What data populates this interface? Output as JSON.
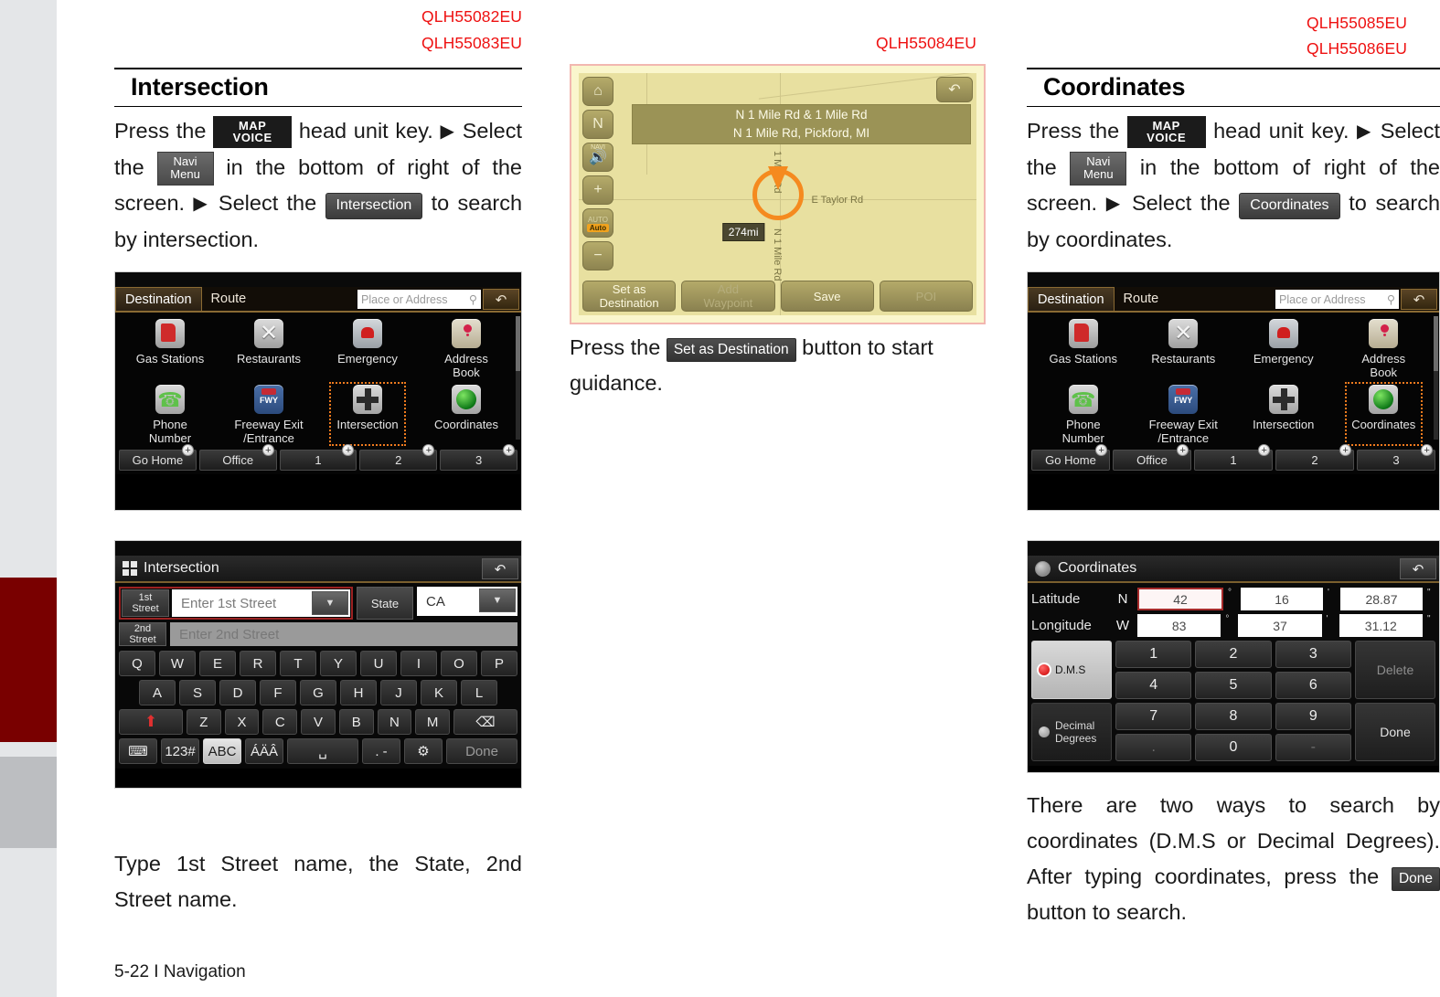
{
  "page": {
    "footer": "5-22 I Navigation"
  },
  "codes": {
    "left_1": "QLH55082EU",
    "left_2": "QLH55083EU",
    "mid_1": "QLH55084EU",
    "right_1": "QLH55085EU",
    "right_2": "QLH55086EU"
  },
  "left_column": {
    "heading": "Intersection",
    "intro": {
      "t1": "Press the",
      "chip_mapvoice_line1": "MAP",
      "chip_mapvoice_line2": "VOICE",
      "t2": "head unit key.",
      "t3": "Select",
      "t4": "the",
      "chip_navi_line1": "Navi",
      "chip_navi_line2": "Menu",
      "t5": "in the bottom of right of the",
      "t6": "screen.",
      "t7": "Select the",
      "chip_action": "Intersection",
      "t8": "to",
      "t9": "search by intersection."
    },
    "caption": "Type 1st Street name, the State, 2nd Street name."
  },
  "mid_column": {
    "caption": {
      "t1": "Press the",
      "chip_action": "Set as Destination",
      "t2": "button to start guidance."
    }
  },
  "right_column": {
    "heading": "Coordinates",
    "intro": {
      "t1": "Press the",
      "chip_mapvoice_line1": "MAP",
      "chip_mapvoice_line2": "VOICE",
      "t2": "head unit key.",
      "t3": "Select",
      "t4": "the",
      "chip_navi_line1": "Navi",
      "chip_navi_line2": "Menu",
      "t5": "in the bottom of right of the",
      "t6": "screen.",
      "t7": "Select the",
      "chip_action": "Coordinates",
      "t8": "to",
      "t9": "search by coordinates."
    },
    "caption": {
      "t1": "There are two ways to search by coordinates (D.M.S or Decimal Degrees). After typing coordinates, press the",
      "chip_action": "Done",
      "t2": "button to search."
    }
  },
  "destination_screen": {
    "tabs": [
      {
        "label": "Destination",
        "active": true
      },
      {
        "label": "Route",
        "active": false
      }
    ],
    "search_placeholder": "Place or Address",
    "search_icon": "magnifier-icon",
    "back_icon": "back-arrow-icon",
    "items": [
      {
        "label": "Gas Stations",
        "icon": "gas-station-icon"
      },
      {
        "label": "Restaurants",
        "icon": "restaurant-icon"
      },
      {
        "label": "Emergency",
        "icon": "emergency-icon"
      },
      {
        "label": "Address\nBook",
        "icon": "address-book-icon"
      },
      {
        "label": "Phone\nNumber",
        "icon": "phone-icon"
      },
      {
        "label": "Freeway Exit\n/Entrance",
        "icon": "freeway-icon"
      },
      {
        "label": "Intersection",
        "icon": "intersection-icon"
      },
      {
        "label": "Coordinates",
        "icon": "coordinates-globe-icon"
      }
    ],
    "selected_left": "Intersection",
    "selected_right": "Coordinates",
    "shortcuts": [
      {
        "label": "Go Home",
        "add": "+"
      },
      {
        "label": "Office",
        "add": "+"
      },
      {
        "label": "1",
        "add": "+"
      },
      {
        "label": "2",
        "add": "+"
      },
      {
        "label": "3",
        "add": "+"
      }
    ]
  },
  "intersection_screen": {
    "title": "Intersection",
    "title_icon": "grid-icon",
    "back_icon": "back-arrow-icon",
    "field1_label_line1": "1st",
    "field1_label_line2": "Street",
    "field1_placeholder": "Enter 1st Street",
    "field1_dropdown_icon": "chevron-down-icon",
    "state_label": "State",
    "state_value": "CA",
    "state_dropdown_icon": "chevron-down-icon",
    "field2_label_line1": "2nd",
    "field2_label_line2": "Street",
    "field2_placeholder": "Enter 2nd Street",
    "keyboard": {
      "row1": [
        "Q",
        "W",
        "E",
        "R",
        "T",
        "Y",
        "U",
        "I",
        "O",
        "P"
      ],
      "row2": [
        "A",
        "S",
        "D",
        "F",
        "G",
        "H",
        "J",
        "K",
        "L"
      ],
      "row3_shift": "⬆",
      "row3": [
        "Z",
        "X",
        "C",
        "V",
        "B",
        "N",
        "M"
      ],
      "row3_backspace": "⌫",
      "row4": [
        {
          "label": "keyboard-layout-icon",
          "kind": "icon"
        },
        {
          "label": "123#",
          "kind": "text"
        },
        {
          "label": "ABC",
          "kind": "text",
          "active": true
        },
        {
          "label": "ÁÄÂ",
          "kind": "text"
        },
        {
          "label": "space-icon",
          "kind": "icon"
        },
        {
          "label": ". -",
          "kind": "text"
        },
        {
          "label": "gear-icon",
          "kind": "icon"
        },
        {
          "label": "Done",
          "kind": "text",
          "dim": true
        }
      ]
    }
  },
  "map_screen": {
    "home_icon": "home-icon",
    "compass_icon": "compass-north-icon",
    "volume_label": "NAVI",
    "volume_icon": "speaker-icon",
    "zoom_in_icon": "plus-icon",
    "zoom_out_icon": "minus-icon",
    "autoscale_top": "AUTO",
    "autoscale_label": "Auto",
    "back_icon": "back-arrow-icon",
    "info_line1": "N 1 Mile Rd & 1 Mile Rd",
    "info_line2": "N 1 Mile Rd, Pickford, MI",
    "distance": "274mi",
    "street_label_east": "E Taylor Rd",
    "street_label_north": "1 Mile Rd",
    "street_label_south": "N 1 Mile Rd",
    "actions": [
      {
        "label": "Set as\nDestination",
        "dim": false
      },
      {
        "label": "Add\nWaypoint",
        "dim": true
      },
      {
        "label": "Save",
        "dim": false
      },
      {
        "label": "POI",
        "dim": true
      }
    ]
  },
  "coordinates_screen": {
    "title": "Coordinates",
    "title_icon": "globe-icon",
    "back_icon": "back-arrow-icon",
    "latitude": {
      "label": "Latitude",
      "direction": "N",
      "degrees": "42",
      "minutes": "16",
      "seconds": "28.87",
      "deg_unit": "°",
      "min_unit": "'",
      "sec_unit": "\""
    },
    "longitude": {
      "label": "Longitude",
      "direction": "W",
      "degrees": "83",
      "minutes": "37",
      "seconds": "31.12",
      "deg_unit": "°",
      "min_unit": "'",
      "sec_unit": "\""
    },
    "modes": [
      {
        "label": "D.M.S",
        "selected": true
      },
      {
        "label": "Decimal\nDegrees",
        "selected": false
      }
    ],
    "keypad": [
      "1",
      "2",
      "3",
      "4",
      "5",
      "6",
      "7",
      "8",
      "9",
      ".",
      "0",
      "-"
    ],
    "delete_label": "Delete",
    "done_label": "Done"
  },
  "colors": {
    "code_red": "#ee1111",
    "sidebar_red": "#790000",
    "sidebar_gray_light": "#e4e6e8",
    "sidebar_gray_mid": "#bcbec1",
    "selection_orange": "#f07b1e",
    "map_bg": "#e8e0a0",
    "map_frame": "#faf6cd"
  }
}
